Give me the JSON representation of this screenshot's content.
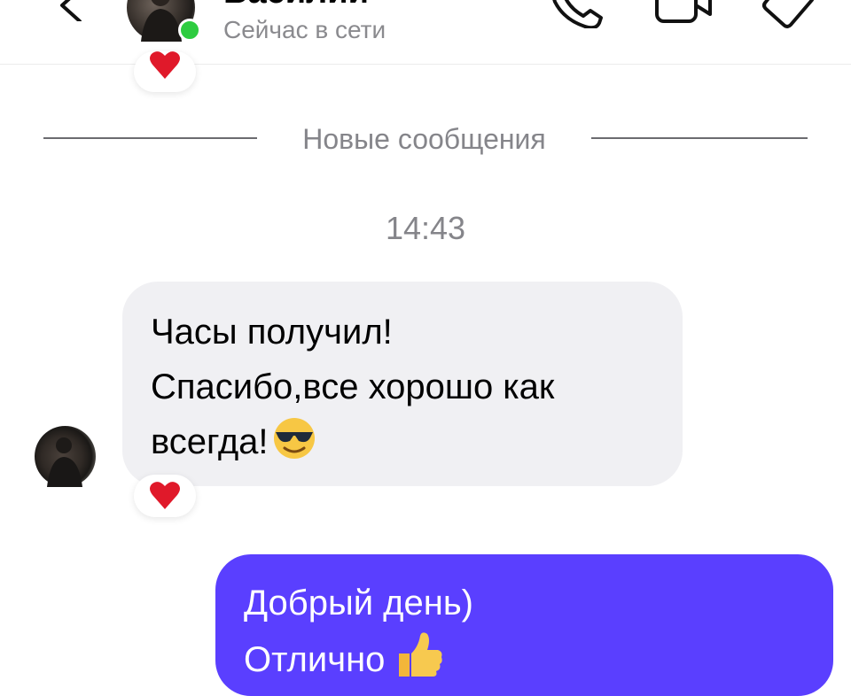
{
  "header": {
    "contact_name": "Василий",
    "status": "Сейчас в сети",
    "online": true,
    "icons": [
      "chevron-left-icon",
      "phone-icon",
      "video-camera-icon",
      "tag-icon"
    ]
  },
  "divider": {
    "label": "Новые сообщения"
  },
  "timestamp": "14:43",
  "messages": {
    "incoming": {
      "lines": [
        "Часы получил!",
        "Спасибо,все хорошо как",
        "всегда!"
      ],
      "emoji": "smiling-face-with-sunglasses",
      "reaction": "red-heart"
    },
    "outgoing": {
      "lines": [
        "Добрый день)",
        "Отлично"
      ],
      "emoji": "thumbs-up"
    }
  },
  "colors": {
    "outgoing_bubble": "#5a3fff",
    "incoming_bubble": "#f0f0f3",
    "online_dot": "#2ecc40",
    "secondary_text": "#85858a",
    "heart": "#e0192a"
  }
}
